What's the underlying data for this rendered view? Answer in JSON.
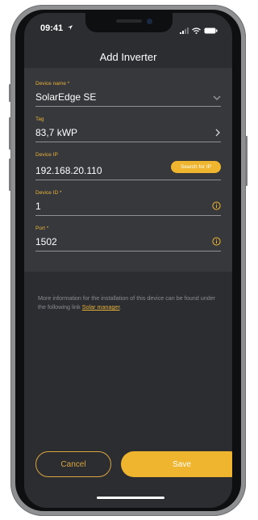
{
  "status_bar": {
    "time": "09:41"
  },
  "header": {
    "title": "Add Inverter"
  },
  "form": {
    "device_name": {
      "label": "Device name *",
      "value": "SolarEdge SE"
    },
    "tag": {
      "label": "Tag",
      "value": "83,7 kWP"
    },
    "device_ip": {
      "label": "Device IP",
      "value": "192.168.20.110",
      "search_button": "Search for IP"
    },
    "device_id": {
      "label": "Device ID *",
      "value": "1"
    },
    "port": {
      "label": "Port *",
      "value": "1502"
    }
  },
  "info": {
    "text": "More information for the installation of this device can be found under the following link ",
    "link_label": "Solar manager",
    "suffix": "."
  },
  "actions": {
    "cancel_label": "Cancel",
    "save_label": "Save"
  },
  "colors": {
    "accent": "#efb52e",
    "background": "#2b2d31",
    "panel": "#36383c"
  },
  "icons": [
    "location-arrow-icon",
    "signal-icon",
    "wifi-icon",
    "battery-icon",
    "chevron-down-icon",
    "chevron-right-icon",
    "info-icon"
  ]
}
